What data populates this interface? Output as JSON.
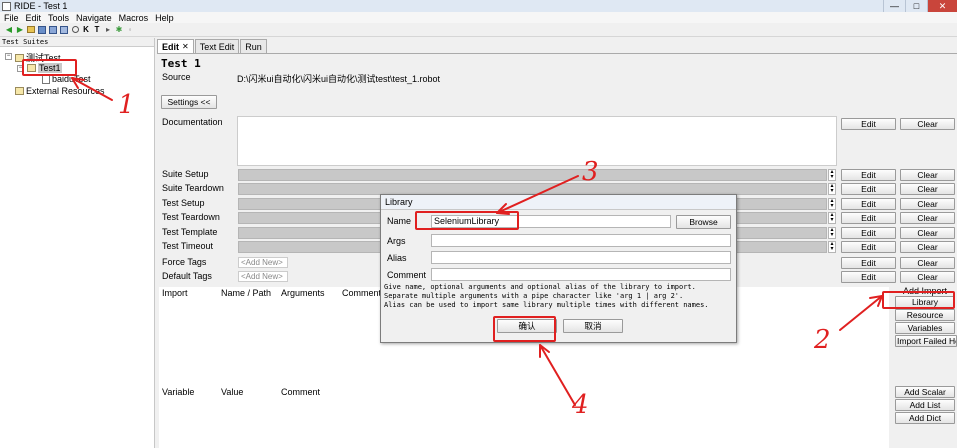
{
  "window": {
    "title": "RIDE - Test 1",
    "controls": [
      "—",
      "□",
      "✕"
    ]
  },
  "menu": [
    "File",
    "Edit",
    "Tools",
    "Navigate",
    "Macros",
    "Help"
  ],
  "toolbar": {
    "k_label": "K",
    "t_label": "T"
  },
  "tree": {
    "header": "Test Suites",
    "root": "测试Test",
    "selected": "Test1",
    "child": "baiduTest",
    "external": "External Resources"
  },
  "tabs": [
    {
      "label": "Edit"
    },
    {
      "label": "Text Edit"
    },
    {
      "label": "Run"
    }
  ],
  "tab_close": "✕",
  "editor": {
    "title": "Test 1",
    "source_label": "Source",
    "source_value": "D:\\闪米ui自动化\\闪米ui自动化\\测试test\\test_1.robot",
    "settings_button": "Settings <<",
    "documentation_label": "Documentation",
    "edit_label": "Edit",
    "clear_label": "Clear",
    "settings": [
      "Suite Setup",
      "Suite Teardown",
      "Test Setup",
      "Test Teardown",
      "Test Template",
      "Test Timeout"
    ],
    "force_tags": "Force Tags",
    "default_tags": "Default Tags",
    "add_new": "<Add New>",
    "import_headers": [
      "Import",
      "Name / Path",
      "Arguments",
      "Comment"
    ],
    "import_buttons": {
      "add_import": "Add Import",
      "library": "Library",
      "resource": "Resource",
      "variables": "Variables",
      "import_failed": "Import Failed Help"
    },
    "variable_headers": [
      "Variable",
      "Value",
      "Comment"
    ],
    "variable_buttons": {
      "add_scalar": "Add Scalar",
      "add_list": "Add List",
      "add_dict": "Add Dict"
    }
  },
  "dialog": {
    "title": "Library",
    "name_label": "Name",
    "name_value": "SeleniumLibrary",
    "browse": "Browse",
    "args_label": "Args",
    "alias_label": "Alias",
    "comment_label": "Comment",
    "help": "Give name, optional arguments and optional alias of the library to import.\nSeparate multiple arguments with a pipe character like 'arg 1 | arg 2'.\nAlias can be used to import same library multiple times with different names.",
    "ok": "确认",
    "cancel": "取消"
  },
  "annotations": {
    "color": "#e02020",
    "n1": "1",
    "n2": "2",
    "n3": "3",
    "n4": "4"
  }
}
